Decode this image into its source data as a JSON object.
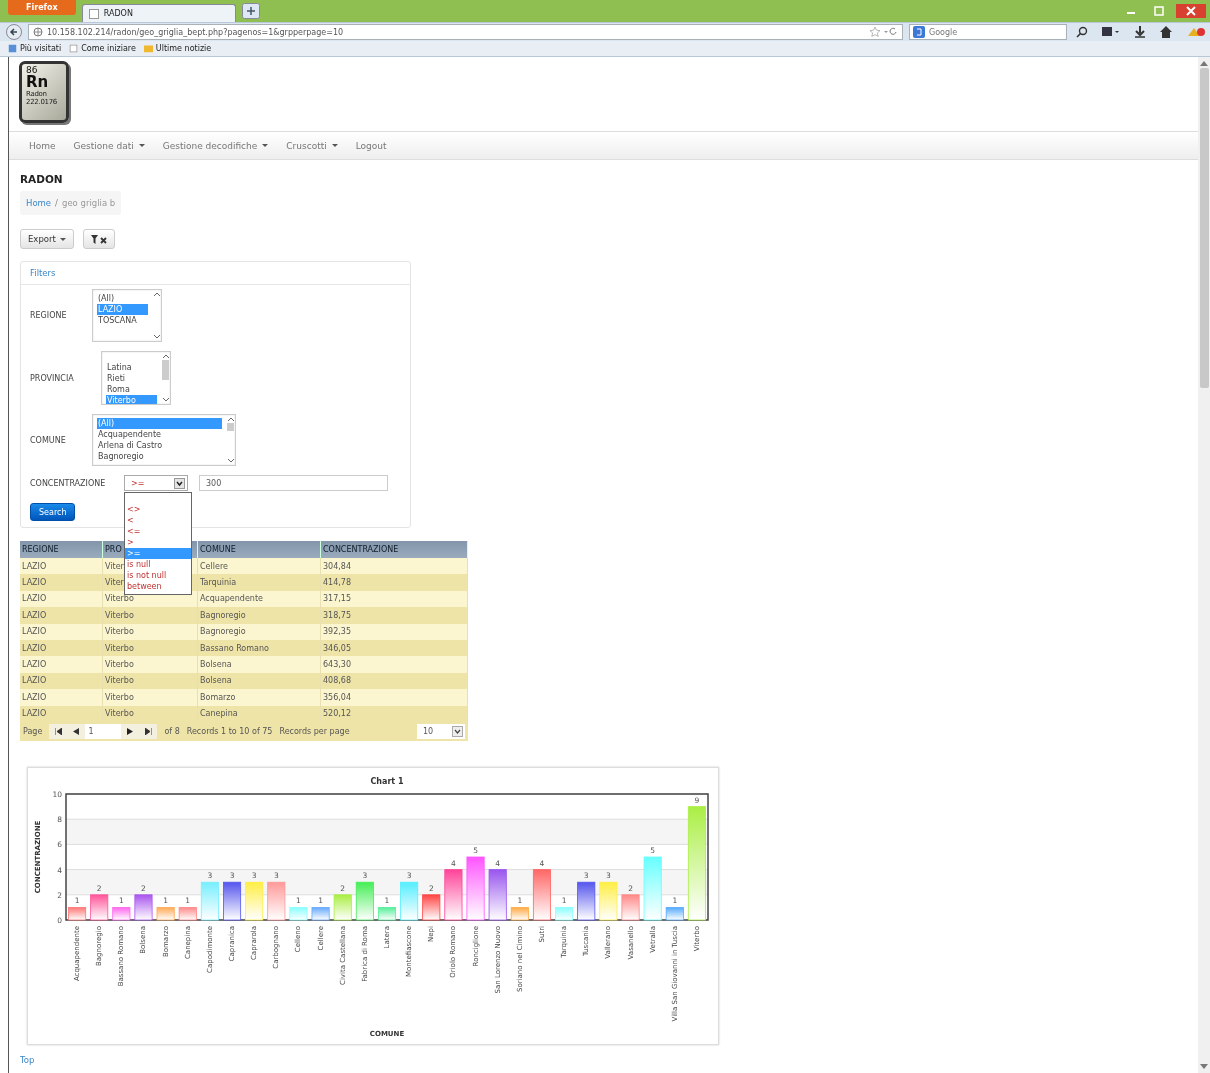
{
  "browser": {
    "menu_button": "Firefox",
    "tab_title": "RADON",
    "address": "10.158.102.214/radon/geo_griglia_bept.php?pagenos=1&grpperpage=10",
    "search_placeholder": "Google",
    "bookmarks": [
      "Più visitati",
      "Come iniziare",
      "Ultime notizie"
    ]
  },
  "logo": {
    "number": "86",
    "symbol": "Rn",
    "name": "Radon",
    "mass": "222.0176"
  },
  "nav": [
    {
      "label": "Home",
      "dropdown": false
    },
    {
      "label": "Gestione dati",
      "dropdown": true
    },
    {
      "label": "Gestione decodifiche",
      "dropdown": true
    },
    {
      "label": "Cruscotti",
      "dropdown": true
    },
    {
      "label": "Logout",
      "dropdown": false
    }
  ],
  "page_title": "RADON",
  "breadcrumb": {
    "separator": "/",
    "items": [
      {
        "label": "Home",
        "link": true
      },
      {
        "label": "geo griglia b",
        "link": false
      }
    ]
  },
  "toolbar": {
    "export": "Export"
  },
  "filters": {
    "title": "Filters",
    "fields": [
      {
        "kind": "listbox",
        "label": "REGIONE",
        "options": [
          {
            "text": "(All)",
            "selected": false
          },
          {
            "text": "LAZIO",
            "selected": true
          },
          {
            "text": "TOSCANA",
            "selected": false
          }
        ]
      },
      {
        "kind": "listbox",
        "label": "PROVINCIA",
        "options": [
          {
            "text": "Latina",
            "selected": false
          },
          {
            "text": "Rieti",
            "selected": false
          },
          {
            "text": "Roma",
            "selected": false
          },
          {
            "text": "Viterbo",
            "selected": true
          }
        ]
      },
      {
        "kind": "listbox",
        "label": "COMUNE",
        "options": [
          {
            "text": "(All)",
            "selected": true
          },
          {
            "text": "Acquapendente",
            "selected": false
          },
          {
            "text": "Arlena di Castro",
            "selected": false
          },
          {
            "text": "Bagnoregio",
            "selected": false
          }
        ]
      },
      {
        "kind": "operator",
        "label": "CONCENTRAZIONE",
        "operator": ">=",
        "value": "300",
        "open": true,
        "options": [
          {
            "text": "<>",
            "selected": false
          },
          {
            "text": "<",
            "selected": false
          },
          {
            "text": "<=",
            "selected": false
          },
          {
            "text": ">",
            "selected": false
          },
          {
            "text": ">=",
            "selected": true
          },
          {
            "text": "is null",
            "selected": false
          },
          {
            "text": "is not null",
            "selected": false
          },
          {
            "text": "between",
            "selected": false
          }
        ]
      }
    ],
    "search": "Search"
  },
  "table": {
    "columns": [
      "REGIONE",
      "PRO",
      "COMUNE",
      "CONCENTRAZIONE"
    ],
    "rows": [
      [
        "LAZIO",
        "Viter",
        "Cellere",
        "304,84"
      ],
      [
        "LAZIO",
        "Viter",
        "Tarquinia",
        "414,78"
      ],
      [
        "LAZIO",
        "Viterbo",
        "Acquapendente",
        "317,15"
      ],
      [
        "LAZIO",
        "Viterbo",
        "Bagnoregio",
        "318,75"
      ],
      [
        "LAZIO",
        "Viterbo",
        "Bagnoregio",
        "392,35"
      ],
      [
        "LAZIO",
        "Viterbo",
        "Bassano Romano",
        "346,05"
      ],
      [
        "LAZIO",
        "Viterbo",
        "Bolsena",
        "643,30"
      ],
      [
        "LAZIO",
        "Viterbo",
        "Bolsena",
        "408,68"
      ],
      [
        "LAZIO",
        "Viterbo",
        "Bomarzo",
        "356,04"
      ],
      [
        "LAZIO",
        "Viterbo",
        "Canepina",
        "520,12"
      ]
    ],
    "pager": {
      "label": "Page",
      "page": "1",
      "of": "of 8",
      "records": "Records 1 to 10 of 75",
      "per_page_label": "Records per page",
      "per_page": "10"
    }
  },
  "chart": {
    "chart_data": {
      "type": "bar",
      "title": "Chart 1",
      "xlabel": "COMUNE",
      "ylabel": "CONCENTRAZIONE",
      "ylim": [
        0,
        10
      ],
      "yticks": [
        0,
        2,
        4,
        6,
        8,
        10
      ],
      "data_labels": true,
      "grid": true,
      "categories": [
        "Acquapendente",
        "Bagnoregio",
        "Bassano Romano",
        "Bolsena",
        "Bomarzo",
        "Canepina",
        "Capodimonte",
        "Capranica",
        "Caprarola",
        "Carbognano",
        "Celleno",
        "Cellere",
        "Civita Castellana",
        "Fabrica di Roma",
        "Latera",
        "Montefiascone",
        "Nepi",
        "Oriolo Romano",
        "Ronciglione",
        "San Lorenzo Nuovo",
        "Soriano nel Cimino",
        "Sutri",
        "Tarquinia",
        "Tuscania",
        "Vallerano",
        "Vasanello",
        "Vetralla",
        "Villa San Giovanni in Tuscia",
        "Viterbo"
      ],
      "values": [
        1,
        2,
        1,
        2,
        1,
        1,
        3,
        3,
        3,
        3,
        1,
        1,
        2,
        3,
        1,
        3,
        2,
        4,
        5,
        4,
        1,
        4,
        1,
        3,
        3,
        2,
        5,
        1,
        9
      ],
      "colors": [
        "#ff7777",
        "#ff5599",
        "#ff66ee",
        "#aa55ee",
        "#ffaa55",
        "#ff8888",
        "#77eeff",
        "#5555ee",
        "#ffee44",
        "#ff9999",
        "#88ffff",
        "#66aaff",
        "#aaee44",
        "#44ee55",
        "#55ee99",
        "#55eeff",
        "#ff4444",
        "#ff4499",
        "#ff55ff",
        "#9955ee",
        "#ffaa44",
        "#ff6666",
        "#88ffff",
        "#5555ee",
        "#ffee44",
        "#ff8888",
        "#66ffff",
        "#55aaff",
        "#aaee44"
      ]
    }
  },
  "footer_link": "Top"
}
